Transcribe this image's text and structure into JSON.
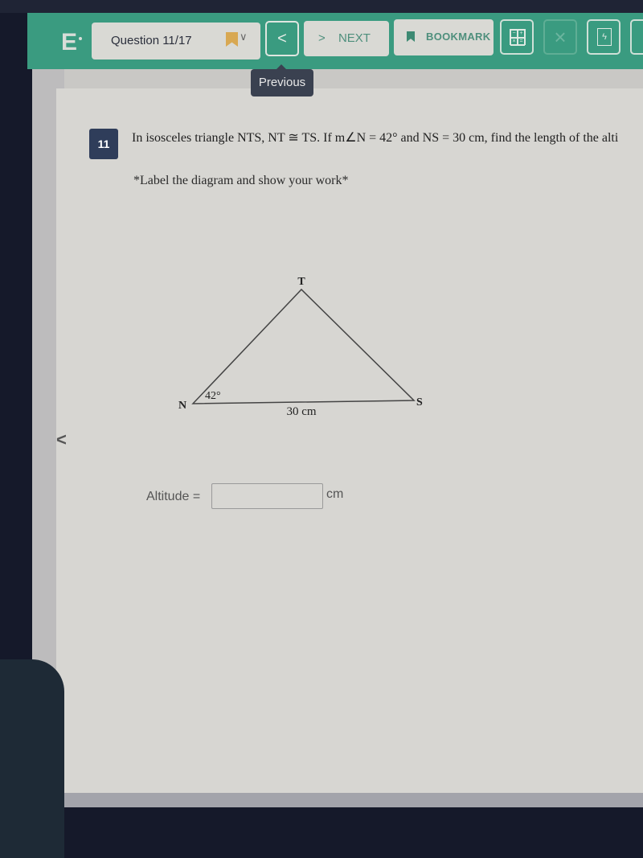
{
  "toolbar": {
    "logo": "E",
    "question_label": "Question 11/17",
    "prev_glyph": "<",
    "next_glyph": ">",
    "next_label": "NEXT",
    "bookmark_label": "BOOKMARK",
    "close_glyph": "×",
    "notes_glyph": "ϟ",
    "calc_cells": [
      "−",
      "+",
      "×",
      "="
    ],
    "colors": {
      "bar": "#3a9b80",
      "accent_text": "#4e8f7c",
      "bookmark_flag": "#d8a852"
    }
  },
  "tooltip": {
    "label": "Previous"
  },
  "question": {
    "number": "11",
    "text": "In isosceles triangle NTS, NT ≅ TS. If m∠N = 42° and NS = 30 cm, find the length of the alti",
    "instruction": "*Label the diagram and show your work*"
  },
  "diagram": {
    "vertices": {
      "top": "T",
      "left": "N",
      "right": "S"
    },
    "angle_label": "42°",
    "base_label": "30 cm"
  },
  "answer": {
    "label": "Altitude =",
    "value": "",
    "unit": "cm"
  },
  "side": {
    "collapse_glyph": "<"
  }
}
